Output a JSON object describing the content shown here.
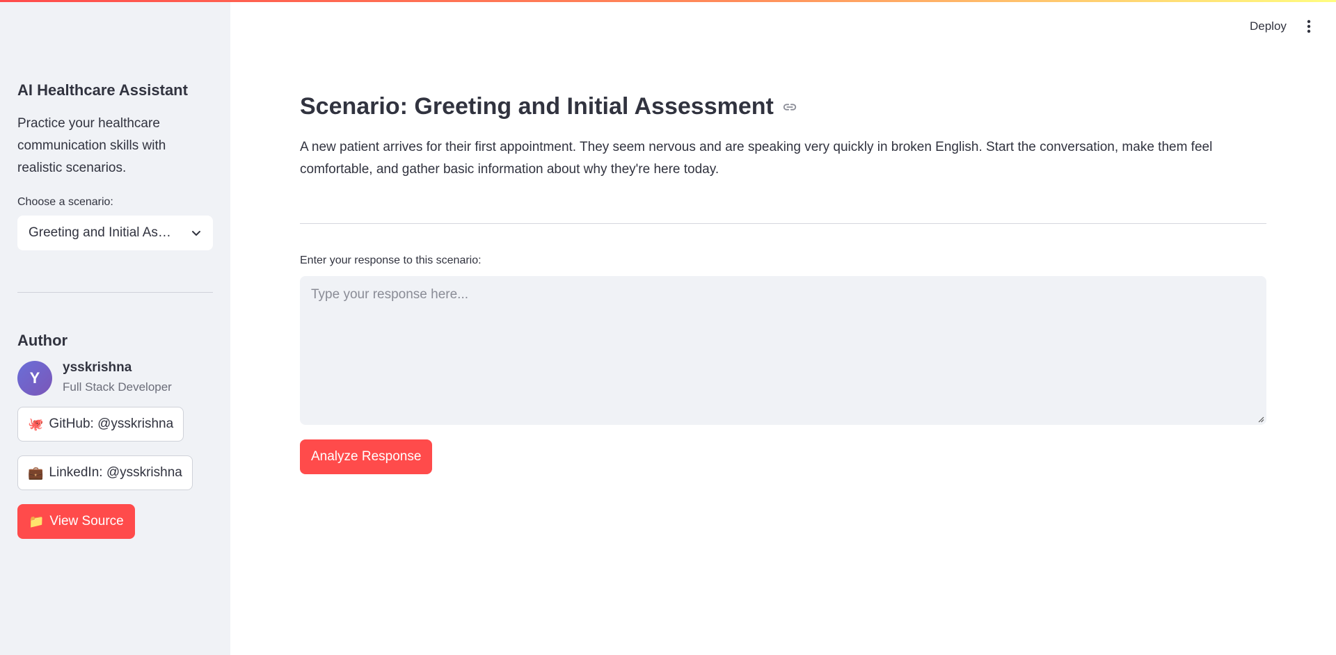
{
  "header": {
    "deploy_label": "Deploy",
    "menu_icon": "vertical-dots-icon"
  },
  "sidebar": {
    "title": "AI Healthcare Assistant",
    "description": "Practice your healthcare communication skills with realistic scenarios.",
    "select_label": "Choose a scenario:",
    "select_value": "Greeting and Initial Assessment",
    "author_heading": "Author",
    "author": {
      "avatar_letter": "Y",
      "name": "ysskrishna",
      "role": "Full Stack Developer"
    },
    "buttons": {
      "github_emoji": "🐙",
      "github_label": "GitHub: @ysskrishna",
      "linkedin_emoji": "💼",
      "linkedin_label": "LinkedIn: @ysskrishna",
      "source_emoji": "📁",
      "source_label": "View Source"
    }
  },
  "main": {
    "scenario_title": "Scenario: Greeting and Initial Assessment",
    "scenario_description": "A new patient arrives for their first appointment. They seem nervous and are speaking very quickly in broken English. Start the conversation, make them feel comfortable, and gather basic information about why they're here today.",
    "response_label": "Enter your response to this scenario:",
    "response_placeholder": "Type your response here...",
    "analyze_label": "Analyze Response"
  },
  "colors": {
    "primary": "#ff4b4b",
    "sidebar_bg": "#f0f2f6",
    "text": "#31333f"
  }
}
